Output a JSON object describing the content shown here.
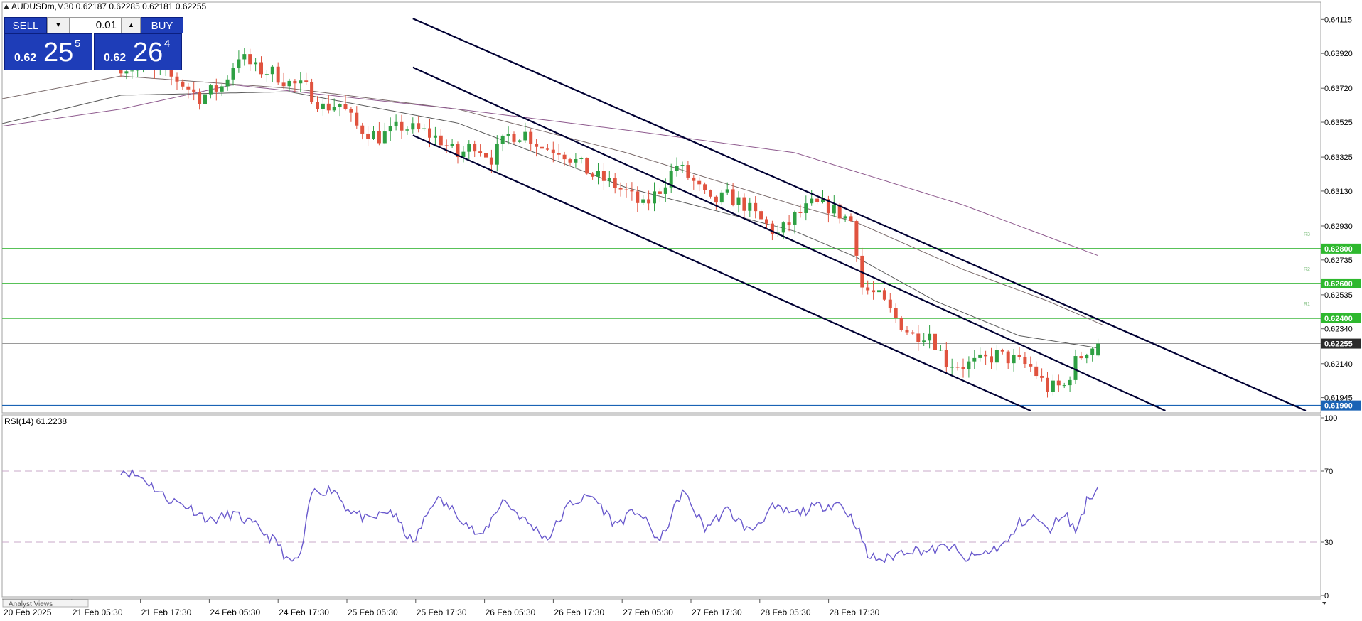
{
  "header": {
    "title": "AUDUSDm,M30  0.62187 0.62285 0.62181 0.62255"
  },
  "trade_panel": {
    "sell_label": "SELL",
    "buy_label": "BUY",
    "lot_value": "0.01",
    "bid": {
      "prefix": "0.62",
      "big": "25",
      "super": "5"
    },
    "ask": {
      "prefix": "0.62",
      "big": "26",
      "super": "4"
    }
  },
  "rsi": {
    "title": "RSI(14) 61.2238",
    "levels": [
      70,
      30
    ]
  },
  "bottom_tab": "Analyst Views",
  "colors": {
    "bull": "#2ea043",
    "bear": "#e0533f",
    "channel": "#000033",
    "level_line": "#40b940",
    "level_tag": "#2eb82e",
    "support_line": "#1a63b5",
    "ma_fast": "#5b5b5b",
    "ma_mid": "#7a6a6a",
    "ma_slow": "#8e5a8e",
    "rsi_line": "#6a5acd",
    "rsi_level": "#c8a8c8"
  },
  "chart_data": {
    "type": "candlestick",
    "symbol": "AUDUSDm",
    "timeframe": "M30",
    "ohlc_last": {
      "open": 0.62187,
      "high": 0.62285,
      "low": 0.62181,
      "close": 0.62255
    },
    "y_range": [
      0.6187,
      0.6421
    ],
    "y_ticks": [
      "0.64115",
      "0.63920",
      "0.63720",
      "0.63525",
      "0.63325",
      "0.63130",
      "0.62930",
      "0.62735",
      "0.62535",
      "0.62340",
      "0.62140",
      "0.61945"
    ],
    "x_ticks": [
      "20 Feb 2025",
      "21 Feb 05:30",
      "21 Feb 17:30",
      "24 Feb 05:30",
      "24 Feb 17:30",
      "25 Feb 05:30",
      "25 Feb 17:30",
      "26 Feb 05:30",
      "26 Feb 17:30",
      "27 Feb 05:30",
      "27 Feb 17:30",
      "28 Feb 05:30",
      "28 Feb 17:30"
    ],
    "price_tags": [
      {
        "label": "0.62800",
        "value": 0.628,
        "kind": "level"
      },
      {
        "label": "0.62600",
        "value": 0.626,
        "kind": "level"
      },
      {
        "label": "0.62400",
        "value": 0.624,
        "kind": "level"
      },
      {
        "label": "0.62255",
        "value": 0.62255,
        "kind": "current"
      },
      {
        "label": "0.61900",
        "value": 0.619,
        "kind": "support"
      }
    ],
    "level_labels": [
      "R3",
      "R2",
      "R1"
    ],
    "close_path": [
      [
        0,
        0.6385
      ],
      [
        6,
        0.6381
      ],
      [
        10,
        0.6377
      ],
      [
        14,
        0.6367
      ],
      [
        18,
        0.6373
      ],
      [
        21,
        0.6391
      ],
      [
        24,
        0.6383
      ],
      [
        27,
        0.6381
      ],
      [
        30,
        0.6375
      ],
      [
        33,
        0.6372
      ],
      [
        36,
        0.6361
      ],
      [
        39,
        0.6363
      ],
      [
        42,
        0.635
      ],
      [
        46,
        0.6344
      ],
      [
        50,
        0.635
      ],
      [
        54,
        0.6347
      ],
      [
        57,
        0.6342
      ],
      [
        60,
        0.6333
      ],
      [
        63,
        0.634
      ],
      [
        66,
        0.6332
      ],
      [
        69,
        0.6345
      ],
      [
        72,
        0.6346
      ],
      [
        75,
        0.6338
      ],
      [
        78,
        0.6337
      ],
      [
        81,
        0.633
      ],
      [
        84,
        0.6322
      ],
      [
        87,
        0.6318
      ],
      [
        90,
        0.6312
      ],
      [
        93,
        0.6304
      ],
      [
        96,
        0.6314
      ],
      [
        99,
        0.6328
      ],
      [
        102,
        0.6318
      ],
      [
        105,
        0.6306
      ],
      [
        108,
        0.631
      ],
      [
        111,
        0.6305
      ],
      [
        114,
        0.6296
      ],
      [
        117,
        0.6288
      ],
      [
        120,
        0.6298
      ],
      [
        123,
        0.6305
      ],
      [
        126,
        0.6304
      ],
      [
        128,
        0.63
      ],
      [
        130,
        0.6296
      ],
      [
        131,
        0.628
      ],
      [
        132,
        0.6258
      ],
      [
        135,
        0.6252
      ],
      [
        138,
        0.624
      ],
      [
        141,
        0.623
      ],
      [
        144,
        0.6232
      ],
      [
        147,
        0.6215
      ],
      [
        150,
        0.6213
      ],
      [
        153,
        0.6215
      ],
      [
        156,
        0.6219
      ],
      [
        159,
        0.6216
      ],
      [
        162,
        0.6212
      ],
      [
        165,
        0.62
      ],
      [
        168,
        0.6201
      ],
      [
        170,
        0.6215
      ],
      [
        172,
        0.6222
      ],
      [
        174,
        0.62255
      ]
    ],
    "moving_averages": [
      {
        "name": "MA fast",
        "points": [
          [
            0,
            0.6368
          ],
          [
            30,
            0.637
          ],
          [
            60,
            0.6352
          ],
          [
            90,
            0.6315
          ],
          [
            120,
            0.629
          ],
          [
            131,
            0.6275
          ],
          [
            145,
            0.625
          ],
          [
            160,
            0.623
          ],
          [
            174,
            0.6223
          ]
        ]
      },
      {
        "name": "MA mid",
        "points": [
          [
            0,
            0.6379
          ],
          [
            30,
            0.6372
          ],
          [
            60,
            0.636
          ],
          [
            90,
            0.6335
          ],
          [
            120,
            0.6305
          ],
          [
            131,
            0.6295
          ],
          [
            150,
            0.6268
          ],
          [
            165,
            0.625
          ],
          [
            175,
            0.6236
          ]
        ]
      },
      {
        "name": "MA slow",
        "points": [
          [
            0,
            0.636
          ],
          [
            20,
            0.6374
          ],
          [
            60,
            0.636
          ],
          [
            90,
            0.6348
          ],
          [
            120,
            0.6335
          ],
          [
            150,
            0.6305
          ],
          [
            174,
            0.6276
          ]
        ]
      }
    ],
    "channel_lines": [
      {
        "p1": [
          52,
          0.6412
        ],
        "p2": [
          211,
          0.6187
        ]
      },
      {
        "p1": [
          52,
          0.6384
        ],
        "p2": [
          186,
          0.6187
        ]
      },
      {
        "p1": [
          52,
          0.6345
        ],
        "p2": [
          162,
          0.6187
        ]
      }
    ],
    "rsi": {
      "period": 14,
      "value": 61.2238,
      "y_range": [
        0,
        100
      ],
      "y_ticks": [
        "100",
        "70",
        "30",
        "0"
      ],
      "points": [
        [
          0,
          71
        ],
        [
          4,
          66
        ],
        [
          8,
          55
        ],
        [
          12,
          50
        ],
        [
          16,
          42
        ],
        [
          20,
          46
        ],
        [
          24,
          39
        ],
        [
          28,
          29
        ],
        [
          30,
          18
        ],
        [
          32,
          22
        ],
        [
          34,
          58
        ],
        [
          38,
          60
        ],
        [
          40,
          50
        ],
        [
          44,
          42
        ],
        [
          48,
          48
        ],
        [
          52,
          29
        ],
        [
          56,
          55
        ],
        [
          60,
          46
        ],
        [
          64,
          32
        ],
        [
          68,
          54
        ],
        [
          72,
          42
        ],
        [
          76,
          32
        ],
        [
          80,
          52
        ],
        [
          84,
          56
        ],
        [
          88,
          40
        ],
        [
          92,
          48
        ],
        [
          96,
          30
        ],
        [
          100,
          59
        ],
        [
          104,
          38
        ],
        [
          108,
          48
        ],
        [
          112,
          36
        ],
        [
          116,
          49
        ],
        [
          120,
          46
        ],
        [
          124,
          50
        ],
        [
          128,
          52
        ],
        [
          131,
          40
        ],
        [
          133,
          22
        ],
        [
          136,
          20
        ],
        [
          140,
          26
        ],
        [
          144,
          25
        ],
        [
          148,
          28
        ],
        [
          150,
          20
        ],
        [
          154,
          24
        ],
        [
          158,
          30
        ],
        [
          160,
          41
        ],
        [
          163,
          44
        ],
        [
          165,
          36
        ],
        [
          168,
          47
        ],
        [
          170,
          36
        ],
        [
          172,
          53
        ],
        [
          174,
          61.2238
        ]
      ]
    }
  }
}
